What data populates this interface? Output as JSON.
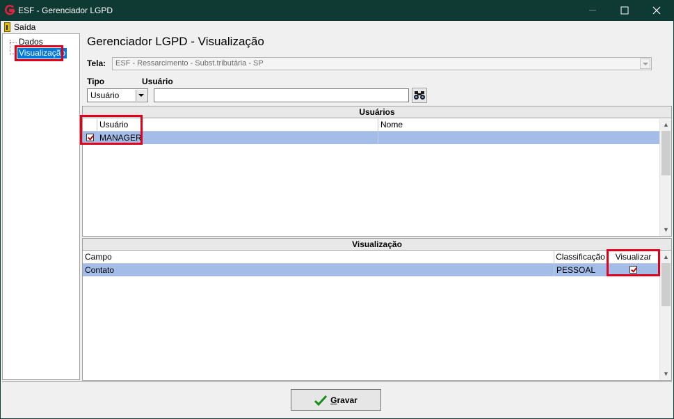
{
  "window": {
    "title": "ESF - Gerenciador LGPD"
  },
  "menu": {
    "items": [
      {
        "label": "Saída",
        "icon": "exit-door-icon"
      }
    ]
  },
  "tree": {
    "items": [
      "Dados",
      "Visualização"
    ],
    "selected": "Visualização"
  },
  "main": {
    "heading": "Gerenciador LGPD - Visualização",
    "tela_label": "Tela:",
    "tela_value": "ESF - Ressarcimento - Subst.tributária - SP",
    "tipo_label": "Tipo",
    "usuario_label": "Usuário",
    "tipo_value": "Usuário",
    "usuario_value": ""
  },
  "usuarios": {
    "title": "Usuários",
    "columns": [
      "Usuário",
      "Nome"
    ],
    "rows": [
      {
        "checked": true,
        "usuario": "MANAGER",
        "nome": ""
      }
    ]
  },
  "visualizacao": {
    "title": "Visualização",
    "columns": [
      "Campo",
      "Classificação",
      "Visualizar"
    ],
    "rows": [
      {
        "campo": "Contato",
        "classificacao": "PESSOAL",
        "visualizar": true
      }
    ]
  },
  "footer": {
    "save_label_prefix": "G",
    "save_label_rest": "ravar"
  },
  "colors": {
    "titlebar": "#0f3a33",
    "selection": "#a3bde8",
    "highlight": "#e0001b",
    "tree_selected": "#0078d7"
  }
}
